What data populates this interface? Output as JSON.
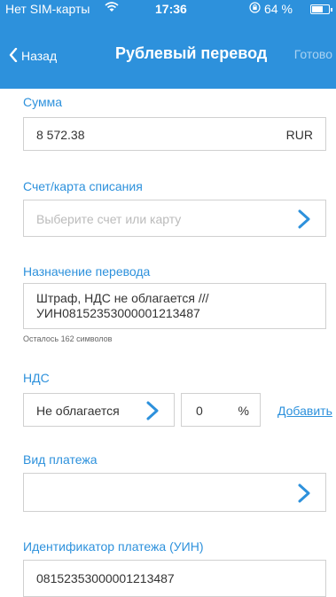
{
  "status_bar": {
    "carrier": "Нет SIM-карты",
    "wifi_icon": "wifi-icon",
    "time": "17:36",
    "lock_icon": "orientation-lock-icon",
    "battery": "64 %",
    "battery_level": 0.64
  },
  "nav": {
    "back_label": "Назад",
    "title": "Рублевый перевод",
    "done_label": "Готово"
  },
  "form": {
    "amount": {
      "label": "Сумма",
      "value": "8 572.38",
      "currency": "RUR"
    },
    "account": {
      "label": "Счет/карта списания",
      "placeholder": "Выберите счет или карту"
    },
    "purpose": {
      "label": "Назначение перевода",
      "line1": "Штраф, НДС не облагается ///",
      "line2": "УИН08152353000001213487",
      "remaining": "Осталось 162 символов"
    },
    "vat": {
      "label": "НДС",
      "type_value": "Не облагается",
      "rate_value": "0",
      "rate_unit": "%",
      "add_label": "Добавить"
    },
    "payment_type": {
      "label": "Вид платежа",
      "value": ""
    },
    "uin": {
      "label": "Идентификатор платежа (УИН)",
      "value": "08152353000001213487"
    }
  },
  "colors": {
    "accent": "#2d91dc",
    "border": "#d0d0d0"
  }
}
